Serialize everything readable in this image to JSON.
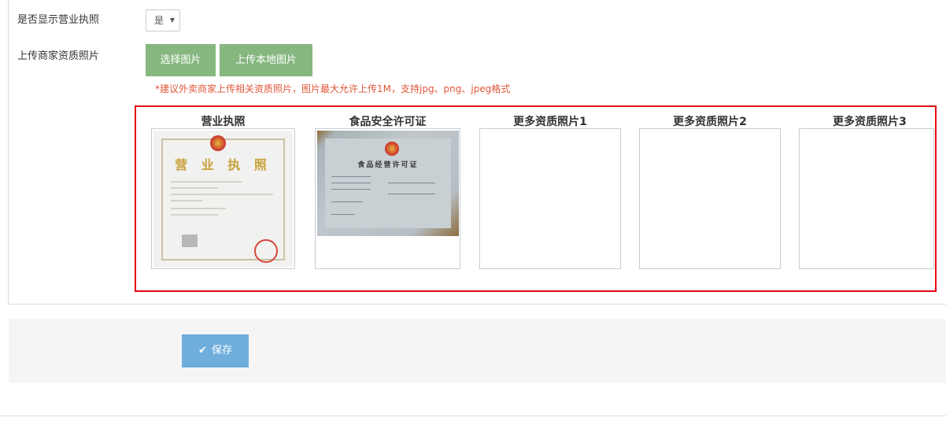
{
  "form": {
    "show_license_label": "是否显示营业执照",
    "show_license_value": "是",
    "upload_label": "上传商家资质照片",
    "select_image_btn": "选择图片",
    "upload_local_btn": "上传本地图片",
    "hint": "*建议外卖商家上传相关资质照片，图片最大允许上传1M，支持jpg、png、jpeg格式"
  },
  "slots": [
    {
      "title": "营业执照"
    },
    {
      "title": "食品安全许可证"
    },
    {
      "title": "更多资质照片1"
    },
    {
      "title": "更多资质照片2"
    },
    {
      "title": "更多资质照片3"
    }
  ],
  "cert_images": {
    "license_heading": "营 业 执 照",
    "food_permit_heading": "食品经营许可证"
  },
  "footer": {
    "save_label": "保存"
  },
  "colors": {
    "accent_green": "#86b77f",
    "save_blue": "#6faedc",
    "hint_red": "#e0573a",
    "highlight_red": "#e60012"
  }
}
